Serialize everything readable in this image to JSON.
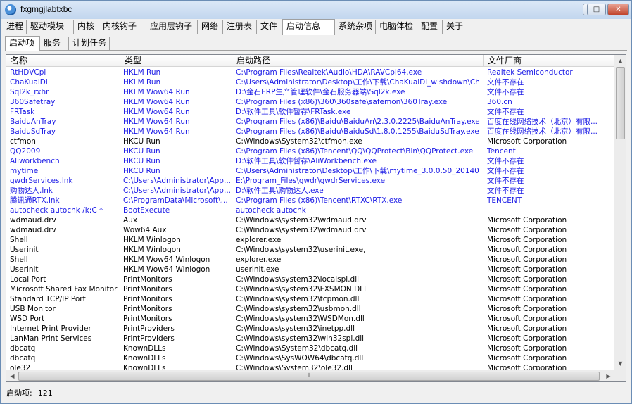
{
  "window": {
    "title": "fxgmgjlabtxbc",
    "min_symbol": "─",
    "max_symbol": "□",
    "close_symbol": "✕"
  },
  "tabs": [
    {
      "label": "进程"
    },
    {
      "label": "驱动模块"
    },
    {
      "label": "内核"
    },
    {
      "label": "内核钩子"
    },
    {
      "label": "应用层钩子"
    },
    {
      "label": "网络"
    },
    {
      "label": "注册表"
    },
    {
      "label": "文件"
    },
    {
      "label": "启动信息"
    },
    {
      "label": "系统杂项"
    },
    {
      "label": "电脑体检"
    },
    {
      "label": "配置"
    },
    {
      "label": "关于"
    }
  ],
  "active_tab": "启动信息",
  "subtabs": [
    {
      "label": "启动项"
    },
    {
      "label": "服务"
    },
    {
      "label": "计划任务"
    }
  ],
  "columns": [
    "名称",
    "类型",
    "启动路径",
    "文件厂商"
  ],
  "colors": {
    "blue": "#1a1ae6",
    "black": "#000000"
  },
  "rows": [
    {
      "name": "RtHDVCpl",
      "type": "HKLM Run",
      "path": "C:\\Program Files\\Realtek\\Audio\\HDA\\RAVCpl64.exe",
      "vendor": "Realtek Semiconductor",
      "blue": true
    },
    {
      "name": "ChaKuaiDi",
      "type": "HKLM Run",
      "path": "C:\\Users\\Administrator\\Desktop\\工作\\下载\\ChaKuaiDi_wishdown\\Ch...",
      "vendor": "文件不存在",
      "blue": true
    },
    {
      "name": "Sql2k_rxhr",
      "type": "HKLM Wow64 Run",
      "path": "D:\\金石ERP生产管理软件\\金石服务器端\\Sql2k.exe",
      "vendor": "文件不存在",
      "blue": true
    },
    {
      "name": "360Safetray",
      "type": "HKLM Wow64 Run",
      "path": "C:\\Program Files (x86)\\360\\360safe\\safemon\\360Tray.exe",
      "vendor": "360.cn",
      "blue": true
    },
    {
      "name": "FRTask",
      "type": "HKLM Wow64 Run",
      "path": "D:\\软件工具\\软件暂存\\FRTask.exe",
      "vendor": "文件不存在",
      "blue": true
    },
    {
      "name": "BaiduAnTray",
      "type": "HKLM Wow64 Run",
      "path": "C:\\Program Files (x86)\\Baidu\\BaiduAn\\2.3.0.2225\\BaiduAnTray.exe",
      "vendor": "百度在线网络技术（北京）有限...",
      "blue": true
    },
    {
      "name": "BaiduSdTray",
      "type": "HKLM Wow64 Run",
      "path": "C:\\Program Files (x86)\\Baidu\\BaiduSd\\1.8.0.1255\\BaiduSdTray.exe",
      "vendor": "百度在线网络技术（北京）有限...",
      "blue": true
    },
    {
      "name": "ctfmon",
      "type": "HKCU Run",
      "path": "C:\\Windows\\System32\\ctfmon.exe",
      "vendor": "Microsoft Corporation",
      "blue": false
    },
    {
      "name": "QQ2009",
      "type": "HKCU Run",
      "path": "C:\\Program Files (x86)\\Tencent\\QQ\\QQProtect\\Bin\\QQProtect.exe",
      "vendor": "Tencent",
      "blue": true
    },
    {
      "name": "Aliworkbench",
      "type": "HKCU Run",
      "path": "D:\\软件工具\\软件暂存\\AliWorkbench.exe",
      "vendor": "文件不存在",
      "blue": true
    },
    {
      "name": "mytime",
      "type": "HKCU Run",
      "path": "C:\\Users\\Administrator\\Desktop\\工作\\下载\\mytime_3.0.0.50_20140...",
      "vendor": "文件不存在",
      "blue": true
    },
    {
      "name": "gwdrServices.lnk",
      "type": "C:\\Users\\Administrator\\App...",
      "path": "E:\\Program_Files\\gwdr\\gwdrServices.exe",
      "vendor": "文件不存在",
      "blue": true
    },
    {
      "name": "购物达人.lnk",
      "type": "C:\\Users\\Administrator\\App...",
      "path": "D:\\软件工具\\购物达人.exe",
      "vendor": "文件不存在",
      "blue": true
    },
    {
      "name": "腾讯通RTX.lnk",
      "type": "C:\\ProgramData\\Microsoft\\...",
      "path": "C:\\Program Files (x86)\\Tencent\\RTXC\\RTX.exe",
      "vendor": "TENCENT",
      "blue": true
    },
    {
      "name": "autocheck autochk /k:C *",
      "type": "BootExecute",
      "path": "autocheck autochk",
      "vendor": "",
      "blue": true
    },
    {
      "name": "wdmaud.drv",
      "type": "Aux",
      "path": "C:\\Windows\\system32\\wdmaud.drv",
      "vendor": "Microsoft Corporation",
      "blue": false
    },
    {
      "name": "wdmaud.drv",
      "type": "Wow64 Aux",
      "path": "C:\\Windows\\system32\\wdmaud.drv",
      "vendor": "Microsoft Corporation",
      "blue": false
    },
    {
      "name": "Shell",
      "type": "HKLM Winlogon",
      "path": "explorer.exe",
      "vendor": "Microsoft Corporation",
      "blue": false
    },
    {
      "name": "Userinit",
      "type": "HKLM Winlogon",
      "path": "C:\\Windows\\system32\\userinit.exe,",
      "vendor": "Microsoft Corporation",
      "blue": false
    },
    {
      "name": "Shell",
      "type": "HKLM Wow64 Winlogon",
      "path": "explorer.exe",
      "vendor": "Microsoft Corporation",
      "blue": false
    },
    {
      "name": "Userinit",
      "type": "HKLM Wow64 Winlogon",
      "path": "userinit.exe",
      "vendor": "Microsoft Corporation",
      "blue": false
    },
    {
      "name": "Local Port",
      "type": "PrintMonitors",
      "path": "C:\\Windows\\system32\\localspl.dll",
      "vendor": "Microsoft Corporation",
      "blue": false
    },
    {
      "name": "Microsoft Shared Fax Monitor",
      "type": "PrintMonitors",
      "path": "C:\\Windows\\system32\\FXSMON.DLL",
      "vendor": "Microsoft Corporation",
      "blue": false
    },
    {
      "name": "Standard TCP/IP Port",
      "type": "PrintMonitors",
      "path": "C:\\Windows\\system32\\tcpmon.dll",
      "vendor": "Microsoft Corporation",
      "blue": false
    },
    {
      "name": "USB Monitor",
      "type": "PrintMonitors",
      "path": "C:\\Windows\\system32\\usbmon.dll",
      "vendor": "Microsoft Corporation",
      "blue": false
    },
    {
      "name": "WSD Port",
      "type": "PrintMonitors",
      "path": "C:\\Windows\\system32\\WSDMon.dll",
      "vendor": "Microsoft Corporation",
      "blue": false
    },
    {
      "name": "Internet Print Provider",
      "type": "PrintProviders",
      "path": "C:\\Windows\\system32\\inetpp.dll",
      "vendor": "Microsoft Corporation",
      "blue": false
    },
    {
      "name": "LanMan Print Services",
      "type": "PrintProviders",
      "path": "C:\\Windows\\system32\\win32spl.dll",
      "vendor": "Microsoft Corporation",
      "blue": false
    },
    {
      "name": "dbcatq",
      "type": "KnownDLLs",
      "path": "C:\\Windows\\System32\\dbcatq.dll",
      "vendor": "Microsoft Corporation",
      "blue": false
    },
    {
      "name": "dbcatq",
      "type": "KnownDLLs",
      "path": "C:\\Windows\\SysWOW64\\dbcatq.dll",
      "vendor": "Microsoft Corporation",
      "blue": false
    },
    {
      "name": "ole32",
      "type": "KnownDLLs",
      "path": "C:\\Windows\\System32\\ole32.dll",
      "vendor": "Microsoft Corporation",
      "blue": false
    }
  ],
  "status": {
    "label": "启动项:",
    "count": "121"
  }
}
